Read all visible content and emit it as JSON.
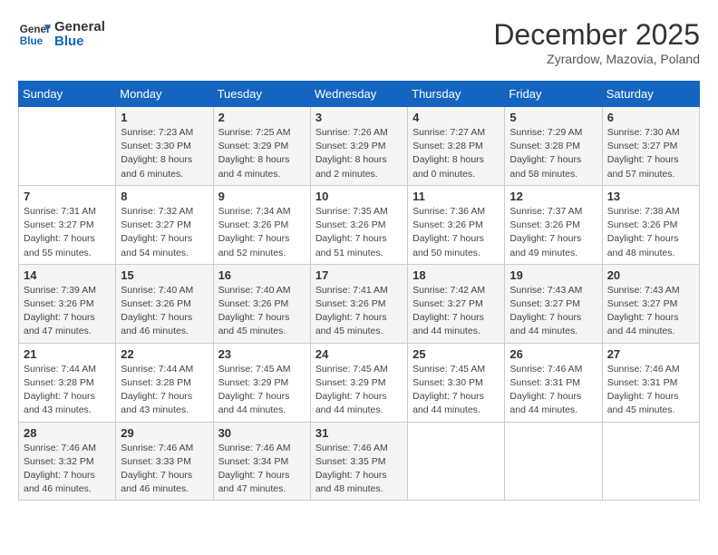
{
  "header": {
    "logo_general": "General",
    "logo_blue": "Blue",
    "month": "December 2025",
    "location": "Zyrardow, Mazovia, Poland"
  },
  "days_of_week": [
    "Sunday",
    "Monday",
    "Tuesday",
    "Wednesday",
    "Thursday",
    "Friday",
    "Saturday"
  ],
  "weeks": [
    [
      {
        "day": "",
        "info": ""
      },
      {
        "day": "1",
        "info": "Sunrise: 7:23 AM\nSunset: 3:30 PM\nDaylight: 8 hours\nand 6 minutes."
      },
      {
        "day": "2",
        "info": "Sunrise: 7:25 AM\nSunset: 3:29 PM\nDaylight: 8 hours\nand 4 minutes."
      },
      {
        "day": "3",
        "info": "Sunrise: 7:26 AM\nSunset: 3:29 PM\nDaylight: 8 hours\nand 2 minutes."
      },
      {
        "day": "4",
        "info": "Sunrise: 7:27 AM\nSunset: 3:28 PM\nDaylight: 8 hours\nand 0 minutes."
      },
      {
        "day": "5",
        "info": "Sunrise: 7:29 AM\nSunset: 3:28 PM\nDaylight: 7 hours\nand 58 minutes."
      },
      {
        "day": "6",
        "info": "Sunrise: 7:30 AM\nSunset: 3:27 PM\nDaylight: 7 hours\nand 57 minutes."
      }
    ],
    [
      {
        "day": "7",
        "info": "Sunrise: 7:31 AM\nSunset: 3:27 PM\nDaylight: 7 hours\nand 55 minutes."
      },
      {
        "day": "8",
        "info": "Sunrise: 7:32 AM\nSunset: 3:27 PM\nDaylight: 7 hours\nand 54 minutes."
      },
      {
        "day": "9",
        "info": "Sunrise: 7:34 AM\nSunset: 3:26 PM\nDaylight: 7 hours\nand 52 minutes."
      },
      {
        "day": "10",
        "info": "Sunrise: 7:35 AM\nSunset: 3:26 PM\nDaylight: 7 hours\nand 51 minutes."
      },
      {
        "day": "11",
        "info": "Sunrise: 7:36 AM\nSunset: 3:26 PM\nDaylight: 7 hours\nand 50 minutes."
      },
      {
        "day": "12",
        "info": "Sunrise: 7:37 AM\nSunset: 3:26 PM\nDaylight: 7 hours\nand 49 minutes."
      },
      {
        "day": "13",
        "info": "Sunrise: 7:38 AM\nSunset: 3:26 PM\nDaylight: 7 hours\nand 48 minutes."
      }
    ],
    [
      {
        "day": "14",
        "info": "Sunrise: 7:39 AM\nSunset: 3:26 PM\nDaylight: 7 hours\nand 47 minutes."
      },
      {
        "day": "15",
        "info": "Sunrise: 7:40 AM\nSunset: 3:26 PM\nDaylight: 7 hours\nand 46 minutes."
      },
      {
        "day": "16",
        "info": "Sunrise: 7:40 AM\nSunset: 3:26 PM\nDaylight: 7 hours\nand 45 minutes."
      },
      {
        "day": "17",
        "info": "Sunrise: 7:41 AM\nSunset: 3:26 PM\nDaylight: 7 hours\nand 45 minutes."
      },
      {
        "day": "18",
        "info": "Sunrise: 7:42 AM\nSunset: 3:27 PM\nDaylight: 7 hours\nand 44 minutes."
      },
      {
        "day": "19",
        "info": "Sunrise: 7:43 AM\nSunset: 3:27 PM\nDaylight: 7 hours\nand 44 minutes."
      },
      {
        "day": "20",
        "info": "Sunrise: 7:43 AM\nSunset: 3:27 PM\nDaylight: 7 hours\nand 44 minutes."
      }
    ],
    [
      {
        "day": "21",
        "info": "Sunrise: 7:44 AM\nSunset: 3:28 PM\nDaylight: 7 hours\nand 43 minutes."
      },
      {
        "day": "22",
        "info": "Sunrise: 7:44 AM\nSunset: 3:28 PM\nDaylight: 7 hours\nand 43 minutes."
      },
      {
        "day": "23",
        "info": "Sunrise: 7:45 AM\nSunset: 3:29 PM\nDaylight: 7 hours\nand 44 minutes."
      },
      {
        "day": "24",
        "info": "Sunrise: 7:45 AM\nSunset: 3:29 PM\nDaylight: 7 hours\nand 44 minutes."
      },
      {
        "day": "25",
        "info": "Sunrise: 7:45 AM\nSunset: 3:30 PM\nDaylight: 7 hours\nand 44 minutes."
      },
      {
        "day": "26",
        "info": "Sunrise: 7:46 AM\nSunset: 3:31 PM\nDaylight: 7 hours\nand 44 minutes."
      },
      {
        "day": "27",
        "info": "Sunrise: 7:46 AM\nSunset: 3:31 PM\nDaylight: 7 hours\nand 45 minutes."
      }
    ],
    [
      {
        "day": "28",
        "info": "Sunrise: 7:46 AM\nSunset: 3:32 PM\nDaylight: 7 hours\nand 46 minutes."
      },
      {
        "day": "29",
        "info": "Sunrise: 7:46 AM\nSunset: 3:33 PM\nDaylight: 7 hours\nand 46 minutes."
      },
      {
        "day": "30",
        "info": "Sunrise: 7:46 AM\nSunset: 3:34 PM\nDaylight: 7 hours\nand 47 minutes."
      },
      {
        "day": "31",
        "info": "Sunrise: 7:46 AM\nSunset: 3:35 PM\nDaylight: 7 hours\nand 48 minutes."
      },
      {
        "day": "",
        "info": ""
      },
      {
        "day": "",
        "info": ""
      },
      {
        "day": "",
        "info": ""
      }
    ]
  ]
}
